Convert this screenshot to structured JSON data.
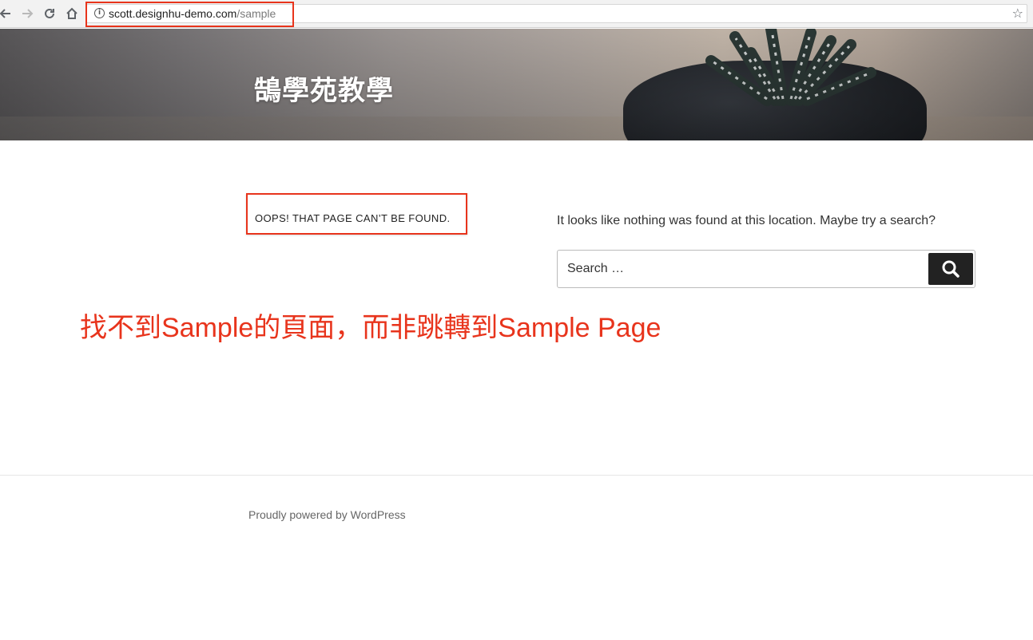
{
  "browser": {
    "url_host": "scott.designhu-demo.com",
    "url_path": "/sample"
  },
  "header": {
    "site_title": "鵠學苑教學"
  },
  "main": {
    "page_title": "OOPS! THAT PAGE CAN’T BE FOUND.",
    "message": "It looks like nothing was found at this location. Maybe try a search?",
    "search": {
      "placeholder": "Search …"
    }
  },
  "annotation": {
    "text": "找不到Sample的頁面，而非跳轉到Sample Page",
    "color": "#e8341c"
  },
  "footer": {
    "credit": "Proudly powered by WordPress"
  },
  "icons": [
    "back-icon",
    "forward-icon",
    "reload-icon",
    "home-icon",
    "info-icon",
    "star-icon",
    "search-icon"
  ]
}
